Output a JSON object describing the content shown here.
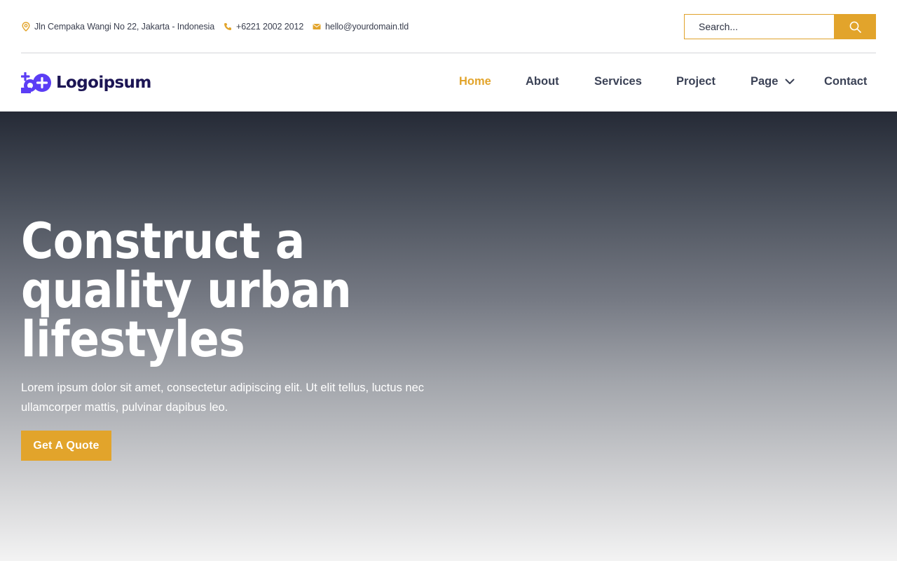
{
  "topbar": {
    "address": "Jln Cempaka Wangi No 22, Jakarta - Indonesia",
    "phone": "+6221 2002 2012",
    "email": "hello@yourdomain.tld",
    "search_placeholder": "Search..."
  },
  "logo": {
    "text": "Logoipsum"
  },
  "nav": {
    "items": [
      {
        "label": "Home",
        "active": true
      },
      {
        "label": "About"
      },
      {
        "label": "Services"
      },
      {
        "label": "Project"
      },
      {
        "label": "Page",
        "has_dropdown": true
      },
      {
        "label": "Contact"
      }
    ]
  },
  "hero": {
    "title": "Construct a quality urban lifestyles",
    "description": "Lorem ipsum dolor sit amet, consectetur adipiscing elit. Ut elit tellus, luctus nec ullamcorper mattis, pulvinar dapibus leo.",
    "cta": "Get A Quote"
  },
  "colors": {
    "accent": "#e2a42b",
    "brand": "#1c1554",
    "logo_icon": "#5b3df5",
    "nav_text": "#3b4256"
  },
  "icons": {
    "address": "map-pin-icon",
    "phone": "phone-icon",
    "email": "envelope-icon",
    "search": "search-icon",
    "dropdown": "chevron-down-icon"
  }
}
